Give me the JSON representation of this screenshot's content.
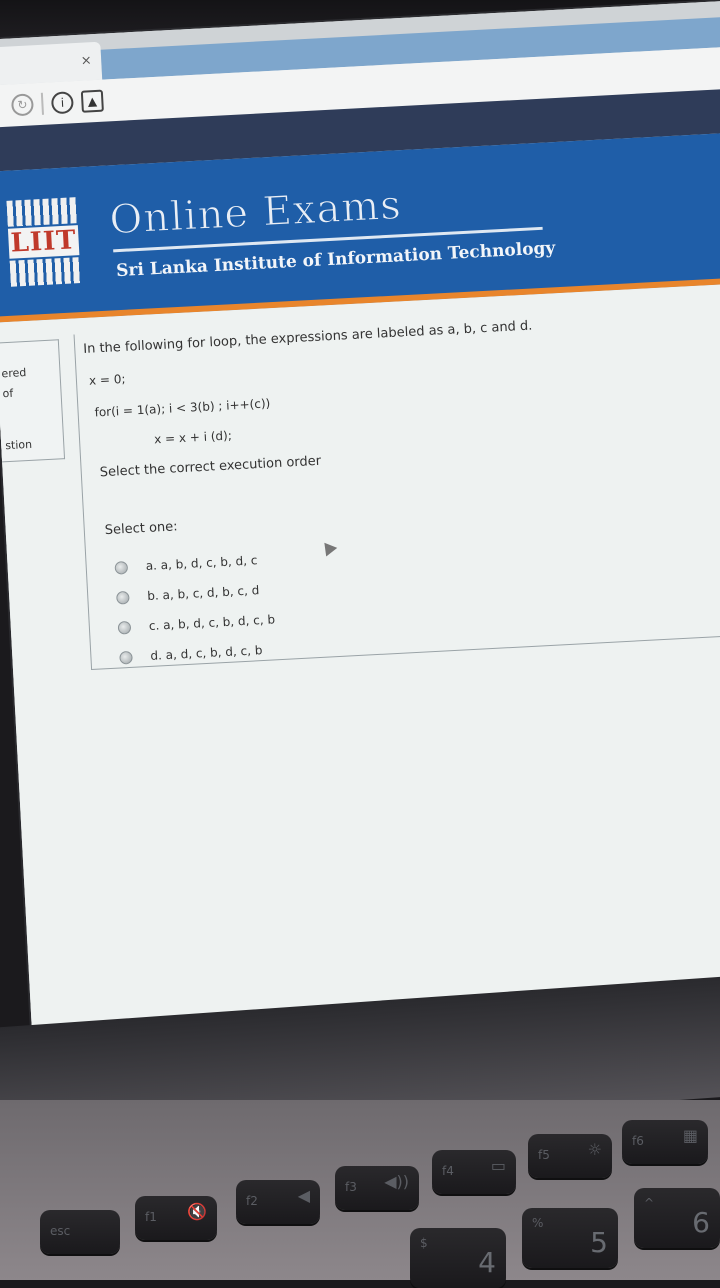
{
  "browser": {
    "tab_close": "×",
    "nav_icons": [
      "reload-icon",
      "info-icon",
      "page-icon"
    ]
  },
  "banner": {
    "logo_text": "LIIT",
    "title": "Online Exams",
    "subtitle": "Sri Lanka Institute of Information Technology"
  },
  "sidebar": {
    "line1": "ered",
    "line2": "of",
    "line3": "stion"
  },
  "question": {
    "intro": "In the following for loop, the expressions are labeled as a, b, c and d.",
    "code_line1": "x = 0;",
    "code_line2": "for(i = 1(a); i < 3(b) ; i++(c))",
    "code_line3": "x = x + i (d);",
    "prompt": "Select the correct execution order",
    "select_one": "Select one:",
    "options": [
      "a. a, b, d, c, b, d, c",
      "b. a, b, c, d, b, c, d",
      "c. a, b, d, c, b, d, c, b",
      "d. a, d, c, b, d, c, b"
    ]
  },
  "keyboard": {
    "esc": "esc",
    "f1": "f1",
    "f2": "f2",
    "f3": "f3",
    "f4": "f4",
    "f5": "f5",
    "f6": "f6",
    "k5": "5",
    "k6": "6",
    "k4": "4",
    "pct": "%",
    "dollar": "$",
    "caret": "^"
  }
}
